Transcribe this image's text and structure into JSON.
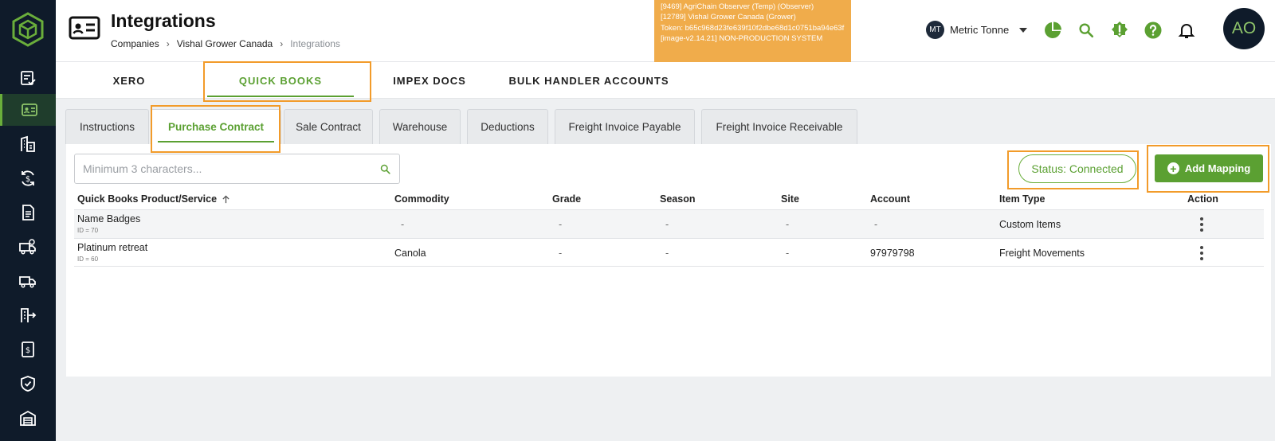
{
  "header": {
    "title": "Integrations",
    "breadcrumb": [
      "Companies",
      "Vishal Grower Canada",
      "Integrations"
    ]
  },
  "env_banner": {
    "lines": [
      "[9469] AgriChain Observer (Temp) (Observer)",
      "[12789] Vishal Grower Canada (Grower)",
      "Token: b65c968d23fe639f10f2dbe68d1c0751ba94e63f",
      "[image-v2.14.21] NON-PRODUCTION SYSTEM"
    ]
  },
  "unit_selector": {
    "initials": "MT",
    "label": "Metric Tonne"
  },
  "user": {
    "initials": "AO"
  },
  "integration_tabs": [
    "XERO",
    "QUICK BOOKS",
    "IMPEX DOCS",
    "BULK HANDLER ACCOUNTS"
  ],
  "sub_tabs": [
    "Instructions",
    "Purchase Contract",
    "Sale Contract",
    "Warehouse",
    "Deductions",
    "Freight Invoice Payable",
    "Freight Invoice Receivable"
  ],
  "search": {
    "placeholder": "Minimum 3 characters..."
  },
  "status": "Status: Connected",
  "add_button": "Add Mapping",
  "table": {
    "columns": [
      "Quick Books Product/Service",
      "Commodity",
      "Grade",
      "Season",
      "Site",
      "Account",
      "Item Type",
      "Action"
    ],
    "rows": [
      {
        "name": "Name Badges",
        "id": "ID = 70",
        "commodity": "-",
        "grade": "-",
        "season": "-",
        "site": "-",
        "account": "-",
        "item_type": "Custom Items"
      },
      {
        "name": "Platinum retreat",
        "id": "ID = 60",
        "commodity": "Canola",
        "grade": "-",
        "season": "-",
        "site": "-",
        "account": "97979798",
        "item_type": "Freight Movements"
      }
    ]
  },
  "colors": {
    "sidebar": "#0f1b2a",
    "accent": "#5ba032",
    "banner": "#f0ac4b",
    "highlight": "#f29b2a"
  }
}
